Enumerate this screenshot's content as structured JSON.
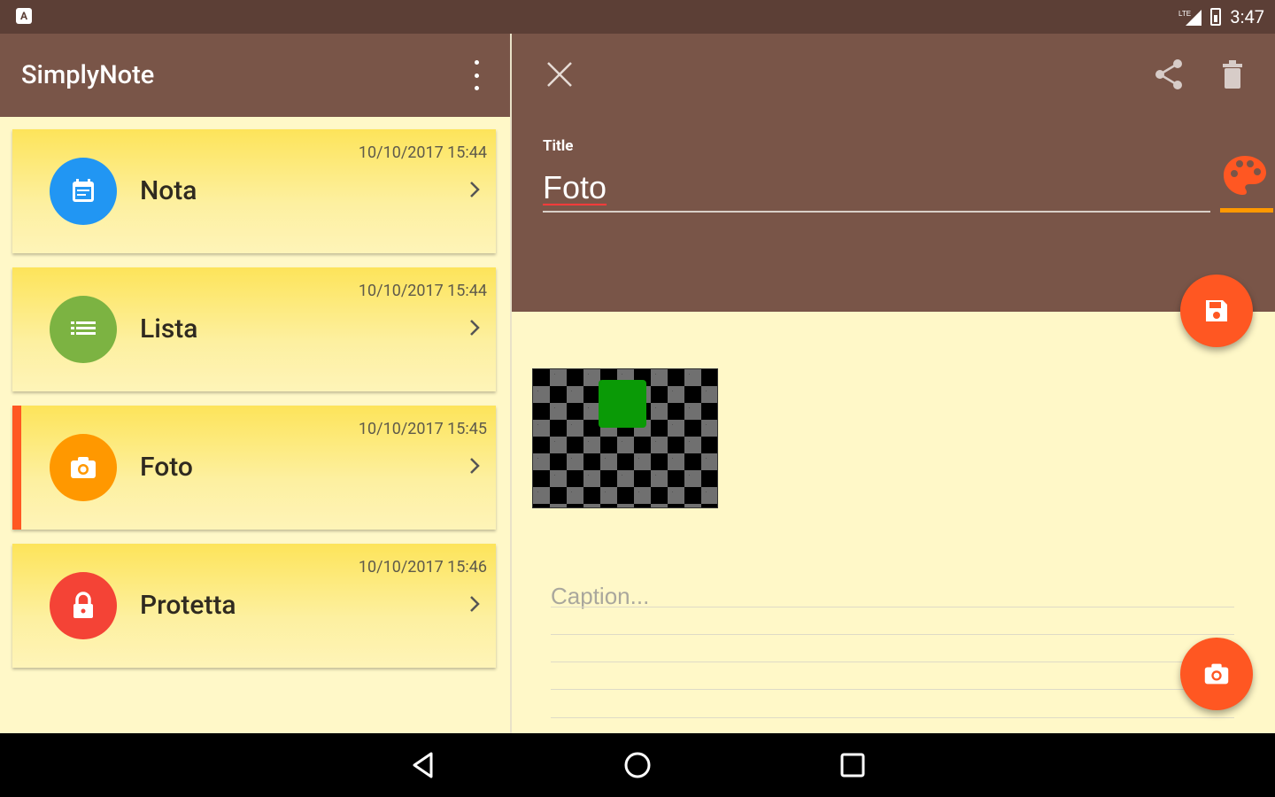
{
  "status_bar": {
    "time": "3:47",
    "left_icon": "notification-icon",
    "signal_icon": "signal-icon",
    "battery_icon": "battery-icon"
  },
  "app": {
    "title": "SimplyNote",
    "overflow_icon": "more-vert-icon"
  },
  "notes": [
    {
      "title": "Nota",
      "date": "10/10/2017 15:44",
      "icon": "note-icon",
      "color": "#2196f3",
      "selected": false
    },
    {
      "title": "Lista",
      "date": "10/10/2017 15:44",
      "icon": "list-icon",
      "color": "#7cb342",
      "selected": false
    },
    {
      "title": "Foto",
      "date": "10/10/2017 15:45",
      "icon": "camera-icon",
      "color": "#ff9800",
      "selected": true
    },
    {
      "title": "Protetta",
      "date": "10/10/2017 15:46",
      "icon": "lock-icon",
      "color": "#f44336",
      "selected": false
    }
  ],
  "editor": {
    "close_icon": "close-icon",
    "share_icon": "share-icon",
    "delete_icon": "delete-icon",
    "title_label": "Title",
    "title_value": "Foto",
    "palette_icon": "palette-icon",
    "save_icon": "save-icon",
    "caption_placeholder": "Caption...",
    "camera_icon": "camera-icon"
  },
  "navigation": {
    "back_icon": "back-icon",
    "home_icon": "home-icon",
    "recents_icon": "recents-icon"
  },
  "colors": {
    "status_bar": "#5c3f36",
    "app_bar": "#795548",
    "accent": "#ff5722",
    "background": "#fff8c8",
    "card": "#fde45a"
  }
}
